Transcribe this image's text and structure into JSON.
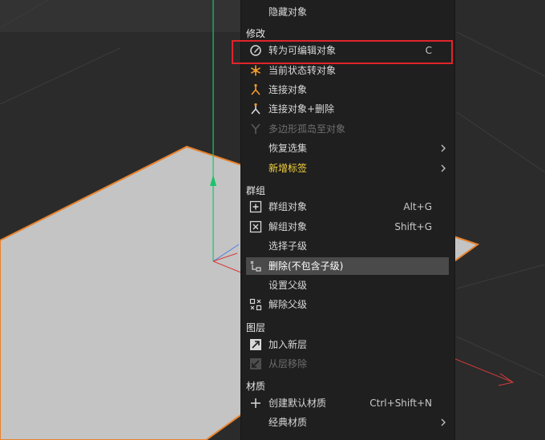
{
  "menu": {
    "hide_object": "隐藏对象",
    "sections": {
      "modify": "修改",
      "group": "群组",
      "layer": "图层",
      "material": "材质"
    },
    "items": {
      "convert_editable": {
        "label": "转为可编辑对象",
        "shortcut": "C",
        "icon": "edit-convert-icon"
      },
      "state_to_object": {
        "label": "当前状态转对象",
        "icon": "state-snowflake-icon"
      },
      "connect_objects": {
        "label": "连接对象",
        "icon": "connect-icon"
      },
      "connect_delete": {
        "label": "连接对象+删除",
        "icon": "connect-delete-icon"
      },
      "polygon_island": {
        "label": "多边形孤岛至对象",
        "icon": "polygon-island-icon"
      },
      "restore_selection": {
        "label": "恢复选集"
      },
      "add_tag": {
        "label": "新增标签"
      },
      "group_objects": {
        "label": "群组对象",
        "shortcut": "Alt+G",
        "icon": "group-plus-icon"
      },
      "ungroup_objects": {
        "label": "解组对象",
        "shortcut": "Shift+G",
        "icon": "ungroup-x-icon"
      },
      "select_children": {
        "label": "选择子级"
      },
      "delete_no_children": {
        "label": "删除(不包含子级)",
        "icon": "delete-hierarchy-icon"
      },
      "set_parent": {
        "label": "设置父级"
      },
      "unparent": {
        "label": "解除父级",
        "icon": "unparent-icon"
      },
      "add_new_layer": {
        "label": "加入新层",
        "icon": "layer-add-icon"
      },
      "remove_from_layer": {
        "label": "从层移除",
        "icon": "layer-remove-icon"
      },
      "create_default_material": {
        "label": "创建默认材质",
        "shortcut": "Ctrl+Shift+N",
        "icon": "plus-icon"
      },
      "classic_material": {
        "label": "经典材质"
      }
    }
  },
  "colors": {
    "viewport_bg": "#2b2b2b",
    "menu_bg": "#1f1f1f",
    "highlight_bg": "#4a4a4a",
    "accent_yellow": "#f4d33f",
    "orange_icon": "#f29b2a",
    "callout_red": "#e0252b",
    "plane_fill": "#c4c4c4",
    "plane_edge": "#e8822c",
    "axis_green": "#19c46a",
    "axis_red": "#d83b3b"
  }
}
